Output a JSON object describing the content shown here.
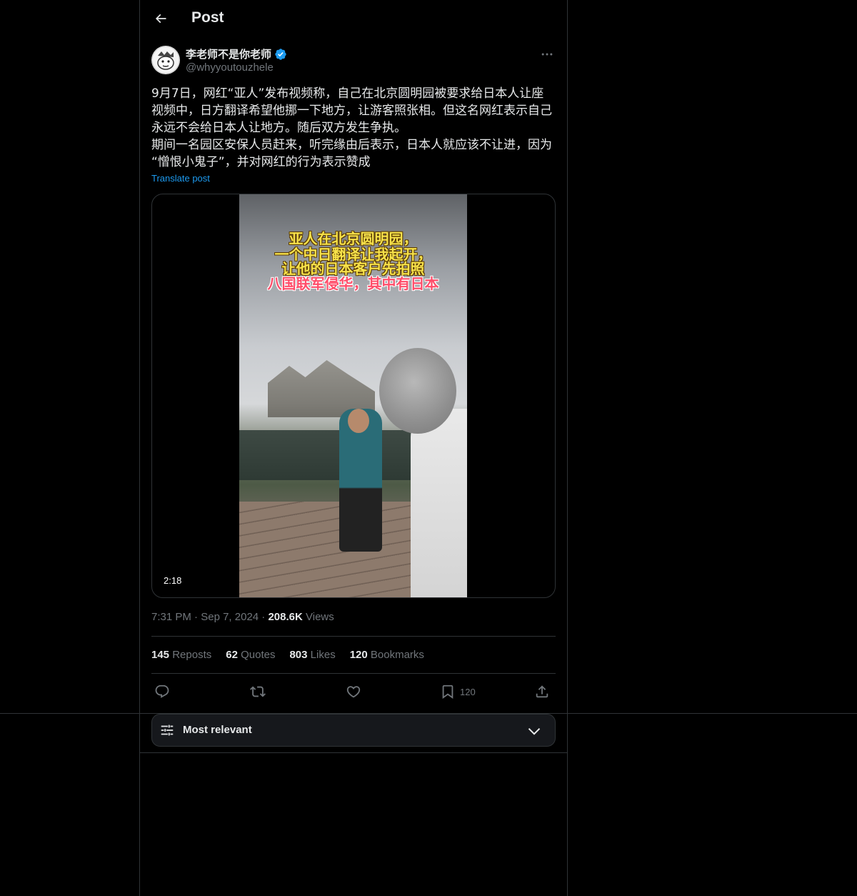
{
  "header": {
    "title": "Post",
    "back_icon": "arrow-left-icon"
  },
  "author": {
    "display_name": "李老师不是你老师",
    "handle": "@whyyoutouzhele",
    "verified": true,
    "verified_color": "#1d9bf0"
  },
  "post": {
    "text": "9月7日，网红“亚人”发布视频称，自己在北京圆明园被要求给日本人让座\n视频中，日方翻译希望他挪一下地方，让游客照张相。但这名网红表示自己\n永远不会给日本人让地方。随后双方发生争执。\n期间一名园区安保人员赶来，听完缘由后表示，日本人就应该不让进，因为\n“憎恨小鬼子”，并对网红的行为表示赞成",
    "translate_label": "Translate post",
    "video": {
      "captions": [
        "亚人在北京圆明园，",
        "一个中日翻译让我起开，",
        "让他的日本客户先拍照",
        "八国联军侵华，其中有日本"
      ],
      "duration": "2:18"
    },
    "time": "7:31 PM",
    "date": "Sep 7, 2024",
    "views_count": "208.6K",
    "views_label": "Views"
  },
  "stats": {
    "reposts": {
      "count": "145",
      "label": "Reposts"
    },
    "quotes": {
      "count": "62",
      "label": "Quotes"
    },
    "likes": {
      "count": "803",
      "label": "Likes"
    },
    "bookmarks": {
      "count": "120",
      "label": "Bookmarks"
    }
  },
  "actions": {
    "reply_icon": "reply-icon",
    "repost_icon": "repost-icon",
    "like_icon": "heart-icon",
    "bookmark_icon": "bookmark-icon",
    "bookmark_count": "120",
    "share_icon": "share-icon"
  },
  "replies_sort": {
    "label": "Most relevant"
  },
  "colors": {
    "background": "#000000",
    "border": "#2f3336",
    "text": "#e7e9ea",
    "muted": "#71767b",
    "accent": "#1d9bf0"
  }
}
